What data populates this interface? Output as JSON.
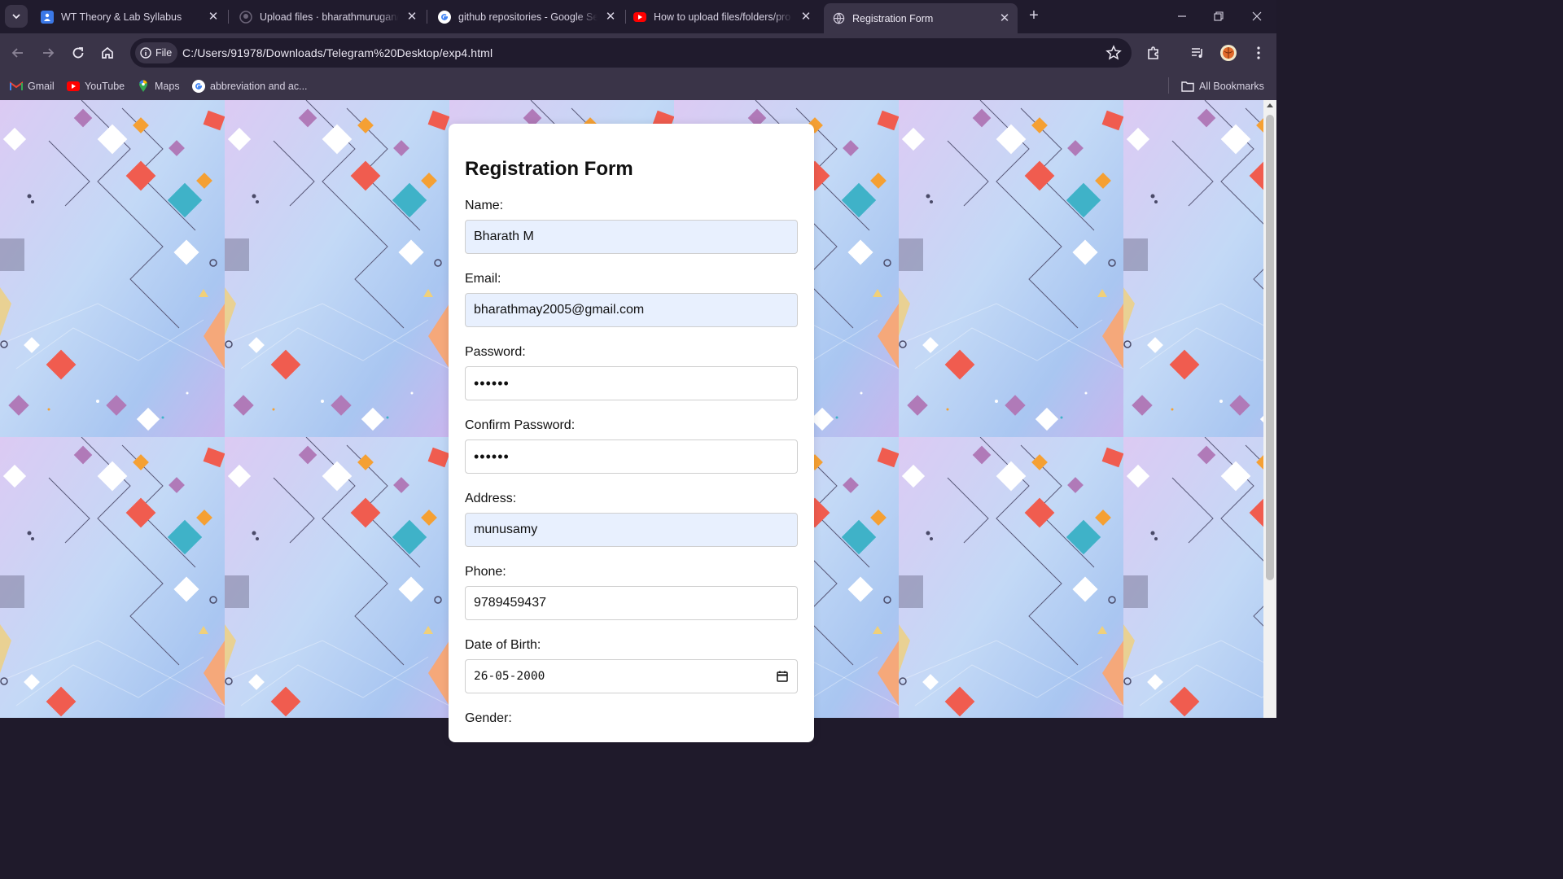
{
  "browser": {
    "tabs": [
      {
        "title": "WT Theory & Lab Syllabus",
        "icon": "google-classroom-icon",
        "active": false
      },
      {
        "title": "Upload files · bharathmurugan/",
        "icon": "github-icon",
        "active": false
      },
      {
        "title": "github repositories - Google Se",
        "icon": "google-icon",
        "active": false
      },
      {
        "title": "How to upload files/folders/pro",
        "icon": "youtube-icon",
        "active": false
      },
      {
        "title": "Registration Form",
        "icon": "globe-icon",
        "active": true
      }
    ],
    "chip_label": "File",
    "url": "C:/Users/91978/Downloads/Telegram%20Desktop/exp4.html",
    "bookmarks": [
      {
        "label": "Gmail",
        "icon": "gmail-icon"
      },
      {
        "label": "YouTube",
        "icon": "youtube-icon"
      },
      {
        "label": "Maps",
        "icon": "maps-icon"
      },
      {
        "label": "abbreviation and ac...",
        "icon": "google-icon"
      }
    ],
    "all_bookmarks_label": "All Bookmarks"
  },
  "form": {
    "title": "Registration Form",
    "name_label": "Name:",
    "name_value": "Bharath M",
    "email_label": "Email:",
    "email_value": "bharathmay2005@gmail.com",
    "password_label": "Password:",
    "password_value": "••••••",
    "confirm_label": "Confirm Password:",
    "confirm_value": "••••••",
    "address_label": "Address:",
    "address_value": "munusamy",
    "phone_label": "Phone:",
    "phone_value": "9789459437",
    "dob_label": "Date of Birth:",
    "dob_value": "26-05-2000",
    "gender_label": "Gender:"
  },
  "colors": {
    "tabstrip_bg": "#201b2d",
    "toolbar_bg": "#3a3448",
    "autofill_bg": "#e8f0fe",
    "card_bg": "#ffffff"
  }
}
